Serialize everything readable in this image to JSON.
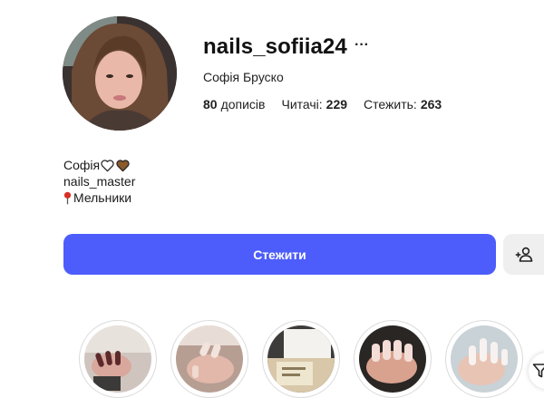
{
  "profile": {
    "username": "nails_sofiia24",
    "more_label": "···",
    "full_name": "Софія Бруско",
    "stats": {
      "posts": {
        "value": "80",
        "label": "дописів"
      },
      "followers": {
        "value": "229",
        "label": "Читачі:"
      },
      "following": {
        "value": "263",
        "label": "Стежить:"
      }
    },
    "avatar_icon": "profile-photo"
  },
  "bio": {
    "line1": "Софія",
    "line1_icons": [
      "white-heart-icon",
      "brown-heart-icon"
    ],
    "line2": "nails_master",
    "line3": "Мельники",
    "line3_icon": "round-pushpin-icon"
  },
  "actions": {
    "follow_label": "Стежити",
    "suggest_icon": "add-user-icon",
    "filter_icon": "filter-icon"
  },
  "highlights": [
    {
      "icon": "highlight-cover"
    },
    {
      "icon": "highlight-cover"
    },
    {
      "icon": "highlight-cover"
    },
    {
      "icon": "highlight-cover"
    },
    {
      "icon": "highlight-cover"
    }
  ],
  "colors": {
    "primary": "#4d5dfb",
    "secondary_button": "#efefef",
    "heart_brown": "#8b5a2b",
    "pin_red": "#d93025"
  }
}
